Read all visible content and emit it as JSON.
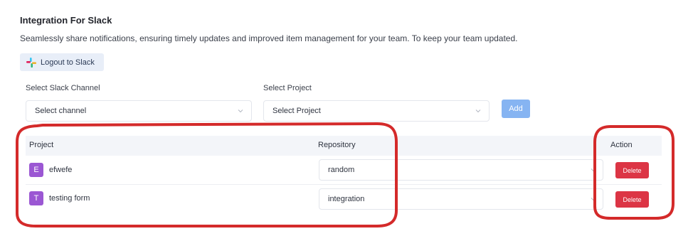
{
  "header": {
    "title": "Integration For Slack",
    "description": "Seamlessly share notifications, ensuring timely updates and improved item management for your team. To keep your team updated."
  },
  "slack_button": {
    "label": "Logout to Slack",
    "icon": "slack-icon"
  },
  "form": {
    "channel_label": "Select Slack Channel",
    "channel_value": "Select channel",
    "project_label": "Select Project",
    "project_value": "Select Project",
    "add_label": "Add"
  },
  "table": {
    "headers": {
      "project": "Project",
      "repository": "Repository",
      "action": "Action"
    },
    "rows": [
      {
        "initial": "E",
        "project": "efwefe",
        "repository": "random",
        "action": "Delete"
      },
      {
        "initial": "T",
        "project": "testing form",
        "repository": "integration",
        "action": "Delete"
      }
    ]
  },
  "colors": {
    "accent": "#86b4f2",
    "danger": "#dc3545",
    "avatar": "#9b57d3",
    "annotation": "#d42a2a"
  }
}
